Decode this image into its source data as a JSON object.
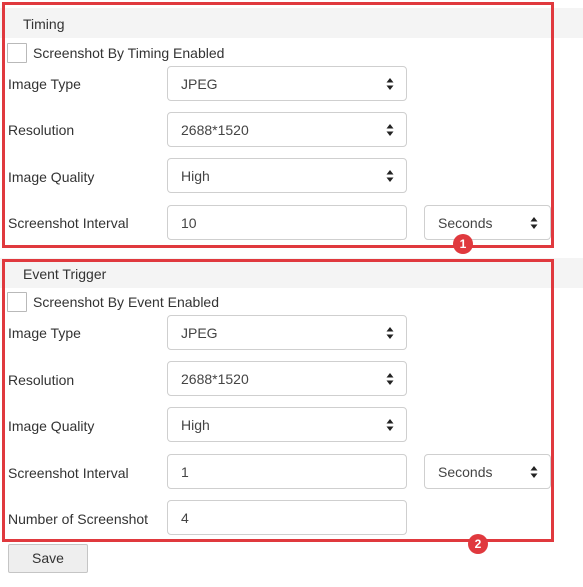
{
  "timing": {
    "title": "Timing",
    "enable_label": "Screenshot By Timing Enabled",
    "enabled": false,
    "image_type_label": "Image Type",
    "image_type_value": "JPEG",
    "resolution_label": "Resolution",
    "resolution_value": "2688*1520",
    "quality_label": "Image Quality",
    "quality_value": "High",
    "interval_label": "Screenshot Interval",
    "interval_value": "10",
    "interval_unit": "Seconds",
    "badge": "1"
  },
  "event": {
    "title": "Event Trigger",
    "enable_label": "Screenshot By Event Enabled",
    "enabled": false,
    "image_type_label": "Image Type",
    "image_type_value": "JPEG",
    "resolution_label": "Resolution",
    "resolution_value": "2688*1520",
    "quality_label": "Image Quality",
    "quality_value": "High",
    "interval_label": "Screenshot Interval",
    "interval_value": "1",
    "interval_unit": "Seconds",
    "count_label": "Number of Screenshot",
    "count_value": "4",
    "badge": "2"
  },
  "actions": {
    "save_label": "Save"
  },
  "colors": {
    "highlight": "#e0393e",
    "header_bg": "#f4f4f4"
  },
  "icons": {
    "select_arrow": "sort-arrows-icon"
  }
}
